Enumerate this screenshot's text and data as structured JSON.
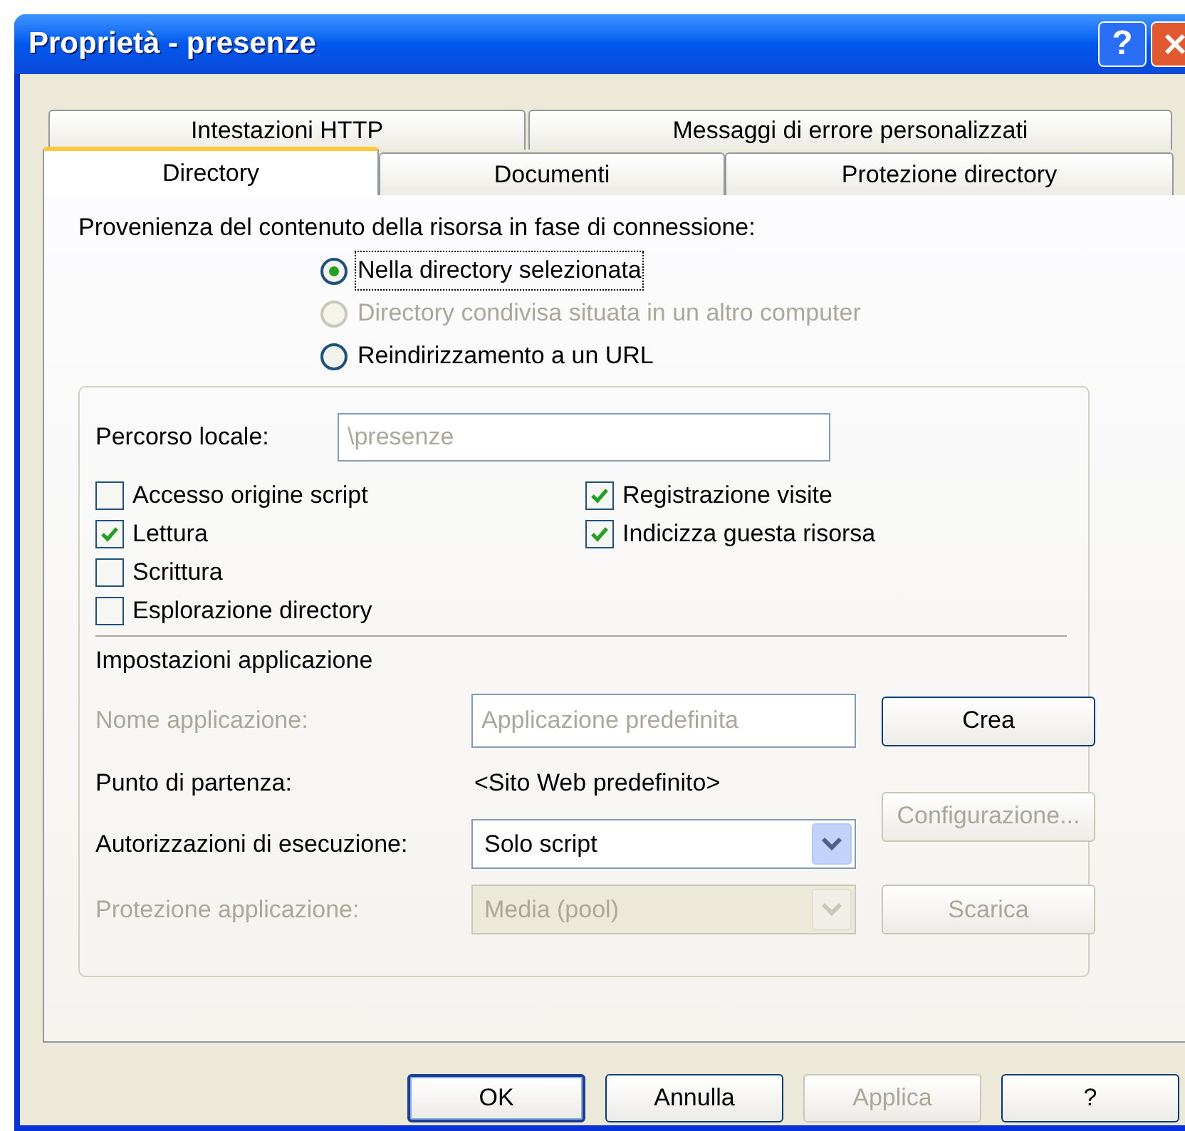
{
  "window": {
    "title": "Proprietà - presenze",
    "help_button": "?"
  },
  "tabs": [
    [
      {
        "label": "Intestazioni HTTP",
        "selected": false
      },
      {
        "label": "Messaggi di errore personalizzati",
        "selected": false
      }
    ],
    [
      {
        "label": "Directory",
        "selected": true
      },
      {
        "label": "Documenti",
        "selected": false
      },
      {
        "label": "Protezione directory",
        "selected": false
      }
    ]
  ],
  "source_label": "Provenienza del contenuto della risorsa in fase di connessione:",
  "radios": [
    {
      "label": "Nella directory selezionata",
      "selected": true,
      "disabled": false,
      "focused": true
    },
    {
      "label": "Directory condivisa situata in un altro computer",
      "selected": false,
      "disabled": true,
      "focused": false
    },
    {
      "label": "Reindirizzamento a un URL",
      "selected": false,
      "disabled": false,
      "focused": false
    }
  ],
  "local_path": {
    "label": "Percorso locale:",
    "value": "\\presenze",
    "disabled": true
  },
  "checkboxes": [
    [
      {
        "label": "Accesso origine script",
        "checked": false
      },
      {
        "label": "Lettura",
        "checked": true
      },
      {
        "label": "Scrittura",
        "checked": false
      },
      {
        "label": "Esplorazione directory",
        "checked": false
      }
    ],
    [
      {
        "label": "Registrazione visite",
        "checked": true
      },
      {
        "label": "Indicizza guesta risorsa",
        "checked": true
      }
    ]
  ],
  "app_settings": {
    "title": "Impostazioni applicazione",
    "rows": [
      {
        "kind": "field",
        "label": "Nome applicazione:",
        "value": "Applicazione predefinita",
        "disabled": true
      },
      {
        "kind": "text",
        "label": "Punto di partenza:",
        "value": "<Sito Web predefinito>",
        "disabled": false
      },
      {
        "kind": "select",
        "label": "Autorizzazioni di esecuzione:",
        "value": "Solo script",
        "disabled": false
      },
      {
        "kind": "select",
        "label": "Protezione applicazione:",
        "value": "Media (pool)",
        "disabled": true
      }
    ],
    "buttons": [
      {
        "label": "Crea",
        "disabled": false
      },
      {
        "label": "Configurazione...",
        "disabled": true
      },
      {
        "label": "Scarica",
        "disabled": true
      }
    ]
  },
  "buttons": [
    {
      "label": "OK",
      "disabled": false,
      "default": true
    },
    {
      "label": "Annulla",
      "disabled": false,
      "default": false
    },
    {
      "label": "Applica",
      "disabled": true,
      "default": false
    },
    {
      "label": "?",
      "disabled": false,
      "default": false
    }
  ]
}
